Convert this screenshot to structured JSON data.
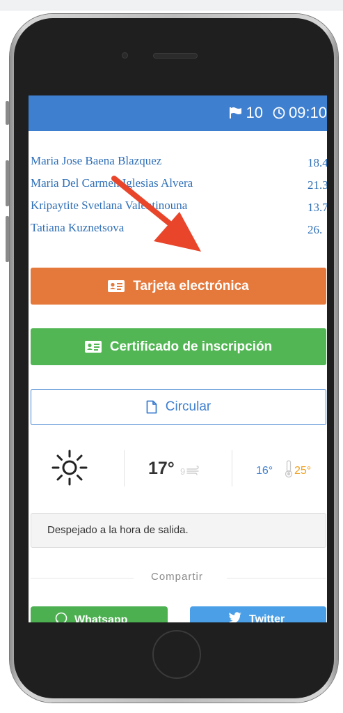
{
  "status_bar": {
    "flag_count": "10",
    "time": "09:10",
    "color": "#3e7fcf"
  },
  "runners": [
    {
      "name": "Maria Jose Baena Blazquez",
      "time": "18.4"
    },
    {
      "name": "Maria Del Carmen Iglesias Alvera",
      "time": "21.3"
    },
    {
      "name": "Kripaytite Svetlana Valentinouna",
      "time": "13.7"
    },
    {
      "name": "Tatiana Kuznetsova",
      "time": "26."
    }
  ],
  "buttons": {
    "tarjeta": {
      "label": "Tarjeta electrónica",
      "icon": "id-card-icon",
      "color": "#e5783b"
    },
    "certificado": {
      "label": "Certificado de inscripción",
      "icon": "id-card-icon",
      "color": "#51b653"
    },
    "circular": {
      "label": "Circular",
      "icon": "document-icon",
      "color": "#3e7fcf"
    }
  },
  "weather": {
    "icon": "sun-icon",
    "temperature": "17°",
    "wind_speed": "9",
    "wind_icon": "wind-icon",
    "min_temp": "16°",
    "max_temp": "25°",
    "thermometer_icon": "thermometer-icon",
    "forecast": "Despejado a la hora de salida."
  },
  "share": {
    "label": "Compartir",
    "whatsapp_label": "Whatsapp",
    "twitter_label": "Twitter",
    "whatsapp_color": "#4caf50",
    "twitter_color": "#4a9fe6"
  },
  "annotation": {
    "arrow_color": "#e8452b"
  }
}
